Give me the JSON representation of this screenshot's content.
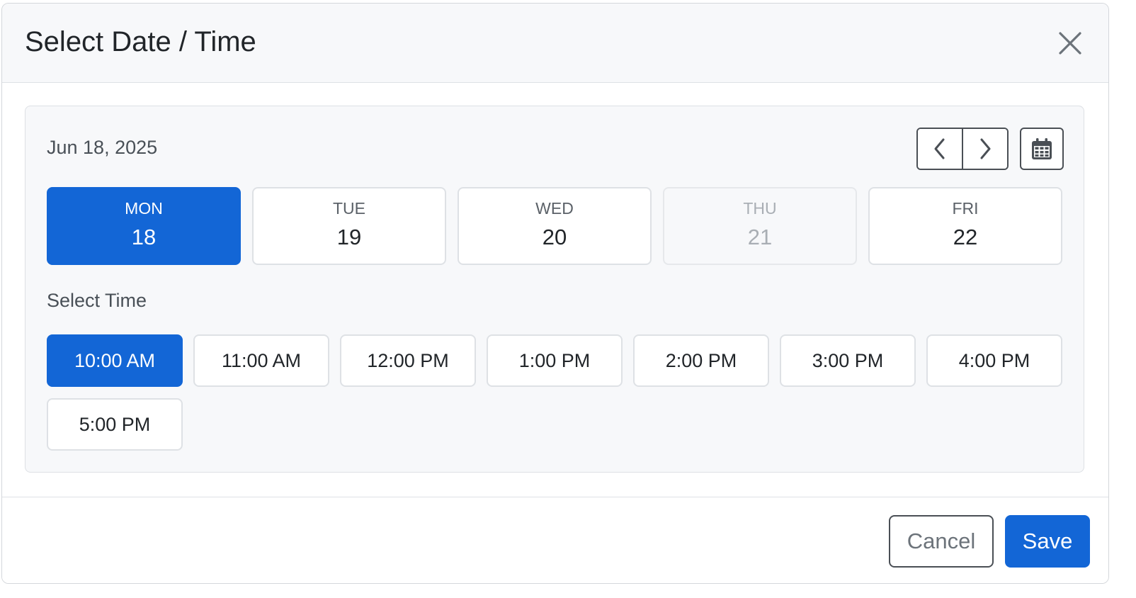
{
  "modal": {
    "title": "Select Date / Time"
  },
  "date_picker": {
    "current_date": "Jun 18, 2025",
    "days": [
      {
        "dow": "MON",
        "num": "18",
        "state": "selected"
      },
      {
        "dow": "TUE",
        "num": "19",
        "state": "available"
      },
      {
        "dow": "WED",
        "num": "20",
        "state": "available"
      },
      {
        "dow": "THU",
        "num": "21",
        "state": "disabled"
      },
      {
        "dow": "FRI",
        "num": "22",
        "state": "available"
      }
    ]
  },
  "time_picker": {
    "label": "Select Time",
    "slots": [
      {
        "label": "10:00 AM",
        "state": "selected"
      },
      {
        "label": "11:00 AM",
        "state": "available"
      },
      {
        "label": "12:00 PM",
        "state": "available"
      },
      {
        "label": "1:00 PM",
        "state": "available"
      },
      {
        "label": "2:00 PM",
        "state": "available"
      },
      {
        "label": "3:00 PM",
        "state": "available"
      },
      {
        "label": "4:00 PM",
        "state": "available"
      },
      {
        "label": "5:00 PM",
        "state": "available"
      }
    ]
  },
  "footer": {
    "cancel_label": "Cancel",
    "save_label": "Save"
  },
  "icons": {
    "close": "close-icon",
    "prev": "chevron-left-icon",
    "next": "chevron-right-icon",
    "calendar": "calendar-icon"
  },
  "colors": {
    "accent": "#1366d6",
    "header_bg": "#f7f8fa",
    "border": "#dee1e5",
    "text": "#212529",
    "muted": "#495057",
    "disabled": "#a9aeb4"
  }
}
